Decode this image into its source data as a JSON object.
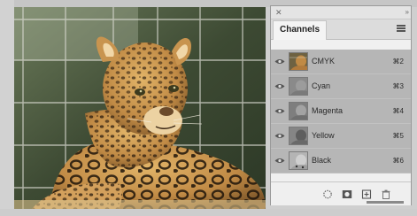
{
  "panel": {
    "tab_label": "Channels",
    "close_icon": "✕",
    "collapse_icon": "»",
    "menu_icon": "panel-menu-icon"
  },
  "channels": [
    {
      "name": "CMYK",
      "shortcut": "⌘2",
      "selected": true,
      "icon": "eye-icon"
    },
    {
      "name": "Cyan",
      "shortcut": "⌘3",
      "selected": true,
      "icon": "eye-icon"
    },
    {
      "name": "Magenta",
      "shortcut": "⌘4",
      "selected": true,
      "icon": "eye-icon"
    },
    {
      "name": "Yellow",
      "shortcut": "⌘5",
      "selected": true,
      "icon": "eye-icon"
    },
    {
      "name": "Black",
      "shortcut": "⌘6",
      "selected": true,
      "icon": "eye-icon"
    }
  ],
  "footer_icons": [
    "load-channel-as-selection-icon",
    "save-selection-as-channel-icon",
    "new-channel-icon",
    "delete-channel-icon"
  ],
  "colors": {
    "selected_row": "#b6b6b6",
    "panel_bg": "#f0f0f0"
  }
}
